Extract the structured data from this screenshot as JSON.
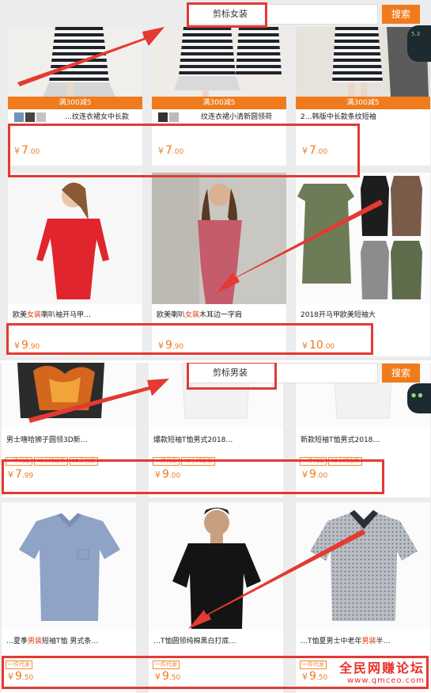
{
  "women": {
    "search": {
      "query": "剪标女装",
      "button_label": "搜索"
    },
    "float_badge": "5.3",
    "row1": [
      {
        "promo": "满300减5",
        "title": "…纹连衣裙女中长款",
        "price_int": "7",
        "price_dec": ".00"
      },
      {
        "promo": "满300减5",
        "title": "纹连衣裙小清新圆领荷",
        "price_int": "7",
        "price_dec": ".00"
      },
      {
        "promo": "满300减5",
        "title": "2…韩版中长款条纹短袖",
        "price_int": "7",
        "price_dec": ".00"
      }
    ],
    "row2": [
      {
        "title_pre": "欧美",
        "title_hl": "女装",
        "title_post": "喇叭袖开马甲…",
        "price_int": "9",
        "price_dec": ".90"
      },
      {
        "title_pre": "欧美喇叭",
        "title_hl": "女装",
        "title_post": "木耳边一字肩",
        "price_int": "9",
        "price_dec": ".90"
      },
      {
        "title_pre": "2018开马甲欧美短袖大",
        "title_hl": "",
        "title_post": "",
        "price_int": "10",
        "price_dec": ".00"
      }
    ]
  },
  "men": {
    "search": {
      "query": "剪标男装",
      "button_label": "搜索"
    },
    "row1": [
      {
        "title": "男士嘻哈狮子圆领3D新…",
        "tags": [
          "一件代发",
          "48小时发货",
          "15天包换"
        ],
        "price_int": "7",
        "price_dec": ".99"
      },
      {
        "title": "爆款短袖T恤男式2018…",
        "tags": [
          "一件代发",
          "48小时发货"
        ],
        "price_int": "9",
        "price_dec": ".00"
      },
      {
        "title": "新款短袖T恤男式2018…",
        "tags": [
          "一件代发",
          "48小时发货"
        ],
        "price_int": "9",
        "price_dec": ".00"
      }
    ],
    "row2": [
      {
        "title_pre": "…夏季",
        "title_hl": "男装",
        "title_post": "短袖T恤 男式条…",
        "tags": [
          "一件代发"
        ],
        "price_int": "9",
        "price_dec": ".50"
      },
      {
        "title_pre": "…T恤圆领纯棉黑白打底…",
        "title_hl": "",
        "title_post": "",
        "tags": [
          "一件代发"
        ],
        "price_int": "9",
        "price_dec": ".50"
      },
      {
        "title_pre": "…T恤夏男士中老年",
        "title_hl": "男装",
        "title_post": "半…",
        "tags": [
          "一件代发"
        ],
        "price_int": "9",
        "price_dec": ".50"
      }
    ]
  },
  "currency": "¥",
  "watermark": {
    "main": "全民网赚论坛",
    "sub": "www.qmceo.com"
  },
  "colors": {
    "accent": "#f07b1d",
    "annotation_red": "#e33a32",
    "highlight": "#e23b1b"
  }
}
